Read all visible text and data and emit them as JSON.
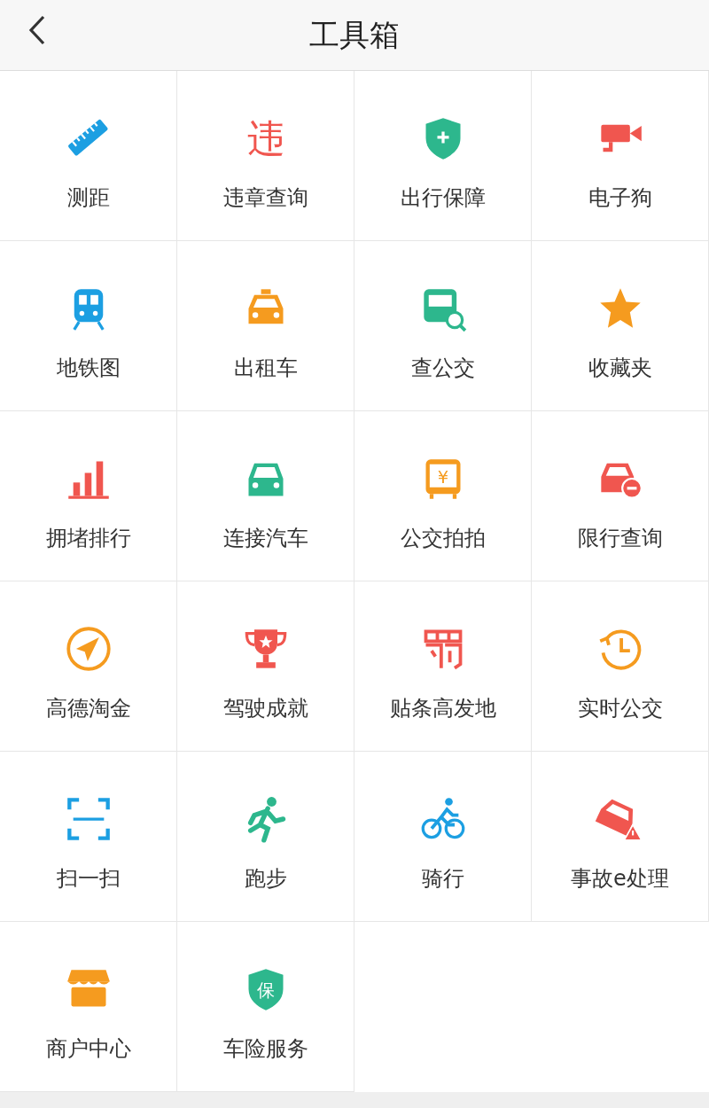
{
  "header": {
    "title": "工具箱"
  },
  "tools": [
    {
      "label": "测距",
      "kind": "ruler"
    },
    {
      "label": "违章查询",
      "kind": "glyph",
      "glyph": "违"
    },
    {
      "label": "出行保障",
      "kind": "shield-plus"
    },
    {
      "label": "电子狗",
      "kind": "camera"
    },
    {
      "label": "地铁图",
      "kind": "subway"
    },
    {
      "label": "出租车",
      "kind": "taxi"
    },
    {
      "label": "查公交",
      "kind": "bus-search"
    },
    {
      "label": "收藏夹",
      "kind": "star"
    },
    {
      "label": "拥堵排行",
      "kind": "bars"
    },
    {
      "label": "连接汽车",
      "kind": "car"
    },
    {
      "label": "公交拍拍",
      "kind": "bus-yen",
      "glyph": "¥"
    },
    {
      "label": "限行查询",
      "kind": "car-minus"
    },
    {
      "label": "高德淘金",
      "kind": "plane"
    },
    {
      "label": "驾驶成就",
      "kind": "trophy"
    },
    {
      "label": "贴条高发地",
      "kind": "ticket"
    },
    {
      "label": "实时公交",
      "kind": "clock"
    },
    {
      "label": "扫一扫",
      "kind": "scan"
    },
    {
      "label": "跑步",
      "kind": "runner"
    },
    {
      "label": "骑行",
      "kind": "bike"
    },
    {
      "label": "事故e处理",
      "kind": "crash"
    },
    {
      "label": "商户中心",
      "kind": "shop"
    },
    {
      "label": "车险服务",
      "kind": "shield-glyph",
      "glyph": "保"
    }
  ]
}
